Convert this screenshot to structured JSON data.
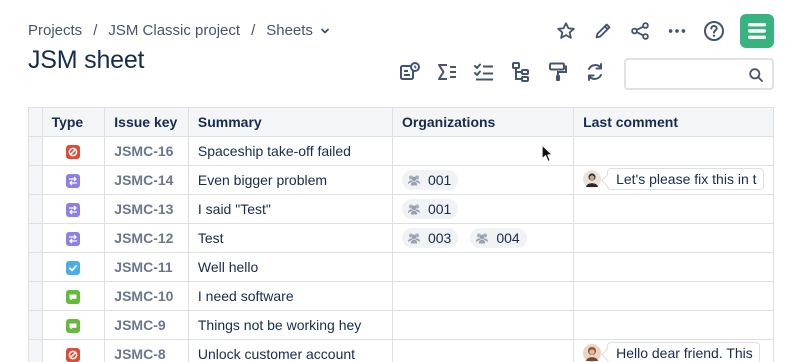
{
  "breadcrumb": {
    "items": [
      "Projects",
      "JSM Classic project",
      "Sheets"
    ],
    "separator": "/"
  },
  "page": {
    "title": "JSM sheet"
  },
  "top_actions": [
    {
      "name": "star-icon"
    },
    {
      "name": "pencil-icon"
    },
    {
      "name": "share-icon"
    },
    {
      "name": "more-icon"
    },
    {
      "name": "help-icon"
    },
    {
      "name": "app-logo-icon"
    }
  ],
  "toolbar": [
    {
      "name": "view-settings-icon"
    },
    {
      "name": "sum-icon"
    },
    {
      "name": "checklist-icon"
    },
    {
      "name": "hierarchy-icon"
    },
    {
      "name": "format-painter-icon"
    },
    {
      "name": "refresh-icon"
    }
  ],
  "search": {
    "value": "",
    "placeholder": ""
  },
  "table": {
    "columns": [
      "Type",
      "Issue key",
      "Summary",
      "Organizations",
      "Last comment"
    ],
    "rows": [
      {
        "type": "incident",
        "key": "JSMC-16",
        "summary": "Spaceship take-off failed",
        "orgs": [],
        "comment": ""
      },
      {
        "type": "change",
        "key": "JSMC-14",
        "summary": "Even bigger problem",
        "orgs": [
          "001"
        ],
        "comment": "Let's please fix this in t",
        "avatar": "dark"
      },
      {
        "type": "change",
        "key": "JSMC-13",
        "summary": "I said \"Test\"",
        "orgs": [
          "001"
        ],
        "comment": ""
      },
      {
        "type": "change",
        "key": "JSMC-12",
        "summary": "Test",
        "orgs": [
          "003",
          "004"
        ],
        "comment": ""
      },
      {
        "type": "task",
        "key": "JSMC-11",
        "summary": "Well hello",
        "orgs": [],
        "comment": ""
      },
      {
        "type": "request",
        "key": "JSMC-10",
        "summary": "I need software",
        "orgs": [],
        "comment": ""
      },
      {
        "type": "request",
        "key": "JSMC-9",
        "summary": "Things not be working hey",
        "orgs": [],
        "comment": ""
      },
      {
        "type": "incident",
        "key": "JSMC-8",
        "summary": "Unlock customer account",
        "orgs": [],
        "comment": "Hello dear friend. This",
        "avatar": "warm"
      }
    ]
  },
  "colors": {
    "incident": "#e34935",
    "change": "#8f7ee7",
    "task": "#4bade8",
    "request": "#63ba3c",
    "logo": "#36b37e"
  }
}
